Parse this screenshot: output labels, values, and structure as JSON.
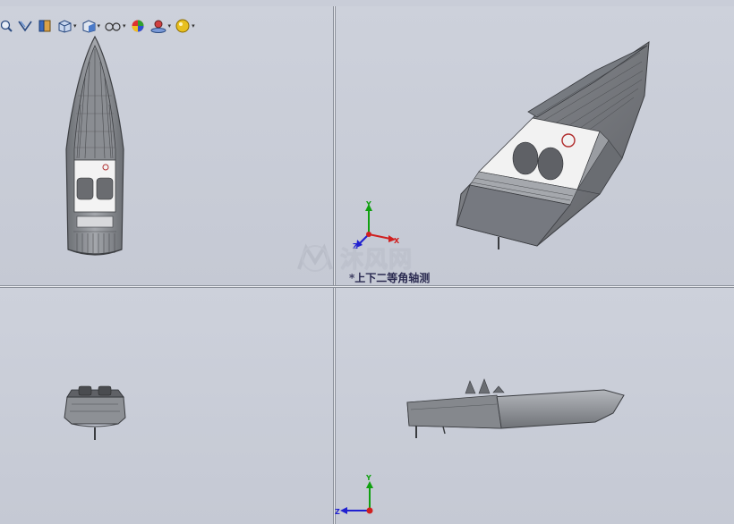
{
  "app": {
    "name": "SolidWorks four-view layout"
  },
  "toolbar": {
    "buttons": [
      {
        "icon": "zoom-to-area-icon",
        "has_dropdown": false
      },
      {
        "icon": "previous-view-icon",
        "has_dropdown": false
      },
      {
        "icon": "section-view-icon",
        "has_dropdown": false
      },
      {
        "icon": "view-orientation-icon",
        "has_dropdown": true
      },
      {
        "icon": "display-style-icon",
        "has_dropdown": true
      },
      {
        "icon": "hide-show-items-icon",
        "has_dropdown": true
      },
      {
        "icon": "edit-appearance-icon",
        "has_dropdown": false
      },
      {
        "icon": "apply-scene-icon",
        "has_dropdown": true
      },
      {
        "icon": "view-settings-icon",
        "has_dropdown": true
      }
    ],
    "dropdown_caret": "▾"
  },
  "viewports": {
    "top_left": {
      "content": "boat-top-view"
    },
    "top_right": {
      "content": "boat-isometric-view",
      "label": "*上下二等角轴测"
    },
    "bottom_left": {
      "content": "boat-front-view"
    },
    "bottom_right": {
      "content": "boat-side-view"
    }
  },
  "triads": {
    "isometric": {
      "x": "X",
      "y": "Y",
      "z": "Z"
    },
    "side": {
      "y": "Y",
      "z": "Z"
    }
  },
  "watermark": {
    "text": "沐风网"
  },
  "colors": {
    "background": "#c7cbd6",
    "axis_x": "#d02020",
    "axis_y": "#10a010",
    "axis_z": "#2020d0",
    "hull": "#8e9196",
    "deck": "#f2f2f2"
  }
}
